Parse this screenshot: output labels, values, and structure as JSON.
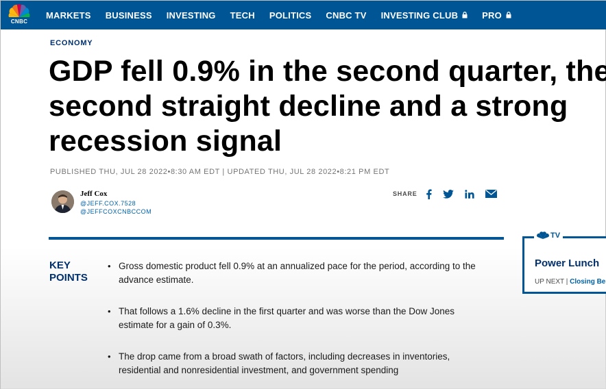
{
  "brand": {
    "logo_text": "CNBC",
    "accent": "#005594",
    "dark": "#002f6c"
  },
  "nav": {
    "items": [
      {
        "label": "MARKETS",
        "locked": false
      },
      {
        "label": "BUSINESS",
        "locked": false
      },
      {
        "label": "INVESTING",
        "locked": false
      },
      {
        "label": "TECH",
        "locked": false
      },
      {
        "label": "POLITICS",
        "locked": false
      },
      {
        "label": "CNBC TV",
        "locked": false
      },
      {
        "label": "INVESTING CLUB",
        "locked": true
      },
      {
        "label": "PRO",
        "locked": true
      }
    ]
  },
  "article": {
    "section": "ECONOMY",
    "headline": "GDP fell 0.9% in the second quarter, the second straight decline and a strong recession signal",
    "dateline": "PUBLISHED THU, JUL 28 2022•8:30 AM EDT | UPDATED THU, JUL 28 2022•8:21 PM EDT",
    "author": {
      "name": "Jeff Cox",
      "handle1": "@JEFF.COX.7528",
      "handle2": "@JEFFCOXCNBCCOM"
    },
    "share": {
      "label": "SHARE",
      "icons": [
        "facebook-icon",
        "twitter-icon",
        "linkedin-icon",
        "email-icon"
      ]
    },
    "key_points": {
      "title": "KEY POINTS",
      "items": [
        "Gross domestic product fell 0.9% at an annualized pace for the period, according to the advance estimate.",
        "That follows a 1.6% decline in the first quarter and was worse than the Dow Jones estimate for a gain of 0.3%.",
        "The drop came from a broad swath of factors, including decreases in inventories, residential and nonresidential investment, and government spending"
      ]
    }
  },
  "tv_widget": {
    "label": "TV",
    "show": "Power Lunch",
    "up_next_label": "UP NEXT |",
    "up_next_show": "Closing Be"
  }
}
